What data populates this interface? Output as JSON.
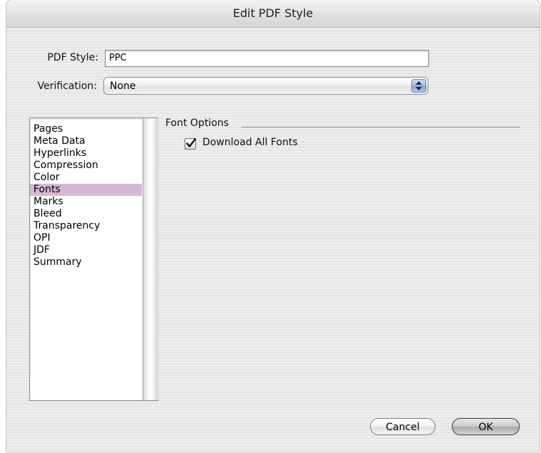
{
  "window": {
    "title": "Edit PDF Style"
  },
  "form": {
    "pdf_style_label": "PDF Style:",
    "pdf_style_value": "PPC",
    "verification_label": "Verification:",
    "verification_value": "None"
  },
  "sidebar": {
    "items": [
      {
        "label": "Pages"
      },
      {
        "label": "Meta Data"
      },
      {
        "label": "Hyperlinks"
      },
      {
        "label": "Compression"
      },
      {
        "label": "Color"
      },
      {
        "label": "Fonts"
      },
      {
        "label": "Marks"
      },
      {
        "label": "Bleed"
      },
      {
        "label": "Transparency"
      },
      {
        "label": "OPI"
      },
      {
        "label": "JDF"
      },
      {
        "label": "Summary"
      }
    ],
    "selected_index": 5
  },
  "font_options": {
    "section_label": "Font Options",
    "download_all_fonts_label": "Download All Fonts",
    "download_all_fonts_checked": true
  },
  "buttons": {
    "cancel_label": "Cancel",
    "ok_label": "OK"
  },
  "colors": {
    "selection": "#d6b7d6",
    "popup_arrow_blue": "#9fb9e0"
  }
}
